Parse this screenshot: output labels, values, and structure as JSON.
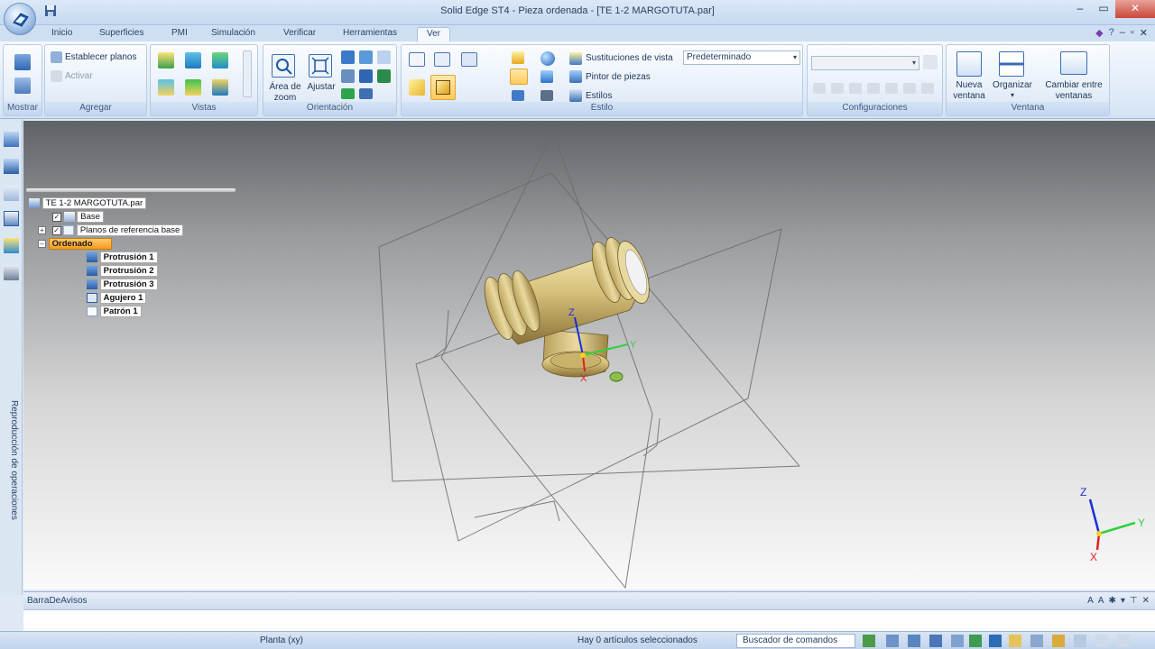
{
  "window": {
    "title": "Solid Edge ST4 - Pieza ordenada - [TE 1-2 MARGOTUTA.par]",
    "minimize": "–",
    "maximize": "▭",
    "close": "✕"
  },
  "tabs": [
    "Inicio",
    "Superficies",
    "PMI",
    "Simulación",
    "Verificar",
    "Herramientas",
    "Ver"
  ],
  "active_tab": "Ver",
  "ribbon": {
    "mostrar": {
      "label": "Mostrar"
    },
    "agregar": {
      "label": "Agregar",
      "establecer_planos": "Establecer planos",
      "activar": "Activar"
    },
    "vistas": {
      "label": "Vistas"
    },
    "orientacion": {
      "label": "Orientación",
      "area_zoom_1": "Área de",
      "area_zoom_2": "zoom",
      "ajustar": "Ajustar"
    },
    "estilo": {
      "label": "Estilo",
      "sustituciones": "Sustituciones de vista",
      "sustituciones_value": "Predeterminado",
      "pintor": "Pintor de piezas",
      "estilos": "Estilos"
    },
    "configuraciones": {
      "label": "Configuraciones"
    },
    "ventana": {
      "label": "Ventana",
      "nueva_1": "Nueva",
      "nueva_2": "ventana",
      "organizar": "Organizar",
      "cambiar_1": "Cambiar entre",
      "cambiar_2": "ventanas"
    }
  },
  "left_panel": {
    "vertical_label": "Reproducción de operaciones"
  },
  "tree": {
    "root": "TE 1-2 MARGOTUTA.par",
    "base": "Base",
    "planos": "Planos de referencia base",
    "ordenado": "Ordenado",
    "features": [
      "Protrusión 1",
      "Protrusión 2",
      "Protrusión 3",
      "Agujero 1",
      "Patrón 1"
    ]
  },
  "triad": {
    "x": "X",
    "y": "Y",
    "z": "Z"
  },
  "avisos": {
    "title": "BarraDeAvisos"
  },
  "status": {
    "view": "Planta (xy)",
    "selection": "Hay 0 artículos seleccionados",
    "command_finder": "Buscador de comandos"
  },
  "colors": {
    "ribbon_bg": "#dfeaf7",
    "highlight": "#f59d1b",
    "part": "#d6bf78",
    "axis_x": "#e0201a",
    "axis_y": "#2fd13a",
    "axis_z": "#1a2fd6"
  }
}
